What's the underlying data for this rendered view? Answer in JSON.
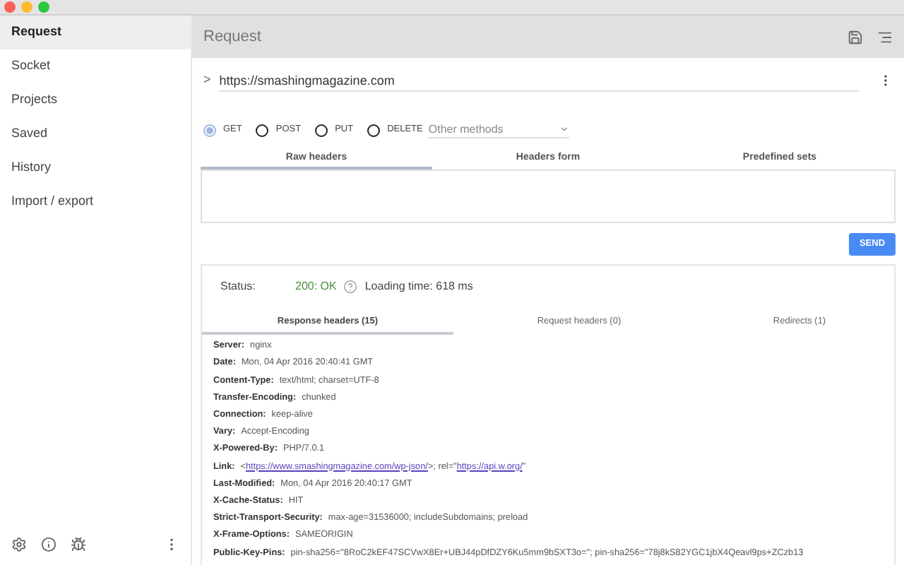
{
  "sidebar": {
    "items": [
      {
        "label": "Request",
        "selected": true
      },
      {
        "label": "Socket",
        "selected": false
      },
      {
        "label": "Projects",
        "selected": false
      },
      {
        "label": "Saved",
        "selected": false
      },
      {
        "label": "History",
        "selected": false
      },
      {
        "label": "Import / export",
        "selected": false
      }
    ]
  },
  "header": {
    "title": "Request"
  },
  "url": {
    "expand": ">",
    "value": "https://smashingmagazine.com"
  },
  "methods": [
    {
      "label": "GET",
      "selected": true
    },
    {
      "label": "POST",
      "selected": false
    },
    {
      "label": "PUT",
      "selected": false
    },
    {
      "label": "DELETE",
      "selected": false
    }
  ],
  "other_methods": {
    "placeholder": "Other methods"
  },
  "header_tabs": [
    {
      "label": "Raw headers",
      "selected": true
    },
    {
      "label": "Headers form",
      "selected": false
    },
    {
      "label": "Predefined sets",
      "selected": false
    }
  ],
  "send_button": "SEND",
  "response": {
    "status_label": "Status:",
    "status": "200: OK",
    "loading": "Loading time: 618 ms",
    "tabs": [
      {
        "label": "Response headers (15)",
        "selected": true
      },
      {
        "label": "Request headers (0)",
        "selected": false
      },
      {
        "label": "Redirects (1)",
        "selected": false
      }
    ],
    "headers": [
      {
        "name": "Server:",
        "value": "nginx"
      },
      {
        "name": "Date:",
        "value": "Mon, 04 Apr 2016 20:40:41 GMT"
      },
      {
        "name": "Content-Type:",
        "value": "text/html; charset=UTF-8"
      },
      {
        "name": "Transfer-Encoding:",
        "value": "chunked"
      },
      {
        "name": "Connection:",
        "value": "keep-alive"
      },
      {
        "name": "Vary:",
        "value": "Accept-Encoding"
      },
      {
        "name": "X-Powered-By:",
        "value": "PHP/7.0.1"
      },
      {
        "name": "Link:",
        "parts": [
          {
            "kind": "text",
            "text": "<"
          },
          {
            "kind": "link",
            "text": "https://www.smashingmagazine.com/wp-json/"
          },
          {
            "kind": "text",
            "text": ">; rel=\""
          },
          {
            "kind": "link",
            "text": "https://api.w.org/"
          },
          {
            "kind": "text",
            "text": "\""
          }
        ]
      },
      {
        "name": "Last-Modified:",
        "value": "Mon, 04 Apr 2016 20:40:17 GMT"
      },
      {
        "name": "X-Cache-Status:",
        "value": "HIT"
      },
      {
        "name": "Strict-Transport-Security:",
        "value": "max-age=31536000; includeSubdomains; preload"
      },
      {
        "name": "X-Frame-Options:",
        "value": "SAMEORIGIN"
      },
      {
        "name": "Public-Key-Pins:",
        "value": "pin-sha256=\"8RoC2kEF47SCVwX8Er+UBJ44pDfDZY6Ku5mm9bSXT3o=\"; pin-sha256=\"78j8kS82YGC1jbX4Qeavl9ps+ZCzb13"
      }
    ]
  }
}
